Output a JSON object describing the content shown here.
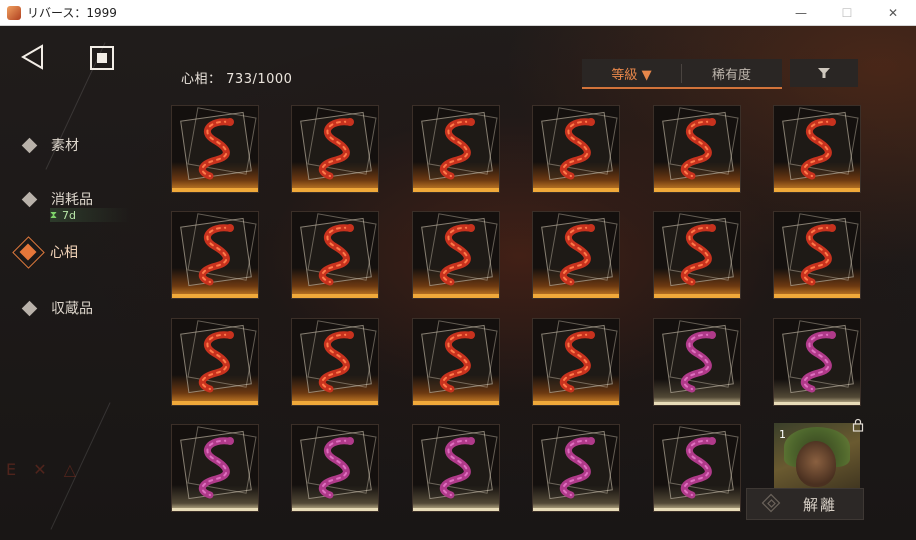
{
  "window": {
    "title": "リバース：1999",
    "minimize_glyph": "—",
    "maximize_glyph": "☐",
    "close_glyph": "✕"
  },
  "nav": {
    "back_icon": "back-triangle-icon",
    "home_icon": "home-square-icon"
  },
  "sidebar": {
    "items": [
      {
        "label": "素材",
        "active": false
      },
      {
        "label": "消耗品",
        "active": false,
        "timer": "7d"
      },
      {
        "label": "心相",
        "active": true
      },
      {
        "label": "収蔵品",
        "active": false
      }
    ]
  },
  "inventory": {
    "count_label": "心相：",
    "count_value": "733/1000"
  },
  "sort": {
    "tabs": [
      {
        "label": "等級",
        "active": true,
        "indicator": "▼"
      },
      {
        "label": "稀有度",
        "active": false
      }
    ],
    "filter_icon": "filter-funnel-icon"
  },
  "grid": {
    "rows": [
      [
        "orange",
        "orange",
        "orange",
        "orange",
        "orange",
        "orange"
      ],
      [
        "orange",
        "orange",
        "orange",
        "orange",
        "orange",
        "orange"
      ],
      [
        "orange",
        "orange",
        "orange",
        "orange",
        "pale",
        "pale"
      ],
      [
        "pale",
        "pale",
        "pale",
        "pale",
        "pale",
        "character"
      ]
    ]
  },
  "equipped": {
    "level": "1",
    "lock_icon": "lock-icon"
  },
  "detach_button": {
    "label": "解離"
  },
  "colors": {
    "accent": "#e6773a",
    "orange_rarity": "#f0a93a",
    "pale_rarity": "#e8dcb8",
    "red_snake": "#c8321e",
    "pink_snake": "#b03a8a"
  }
}
